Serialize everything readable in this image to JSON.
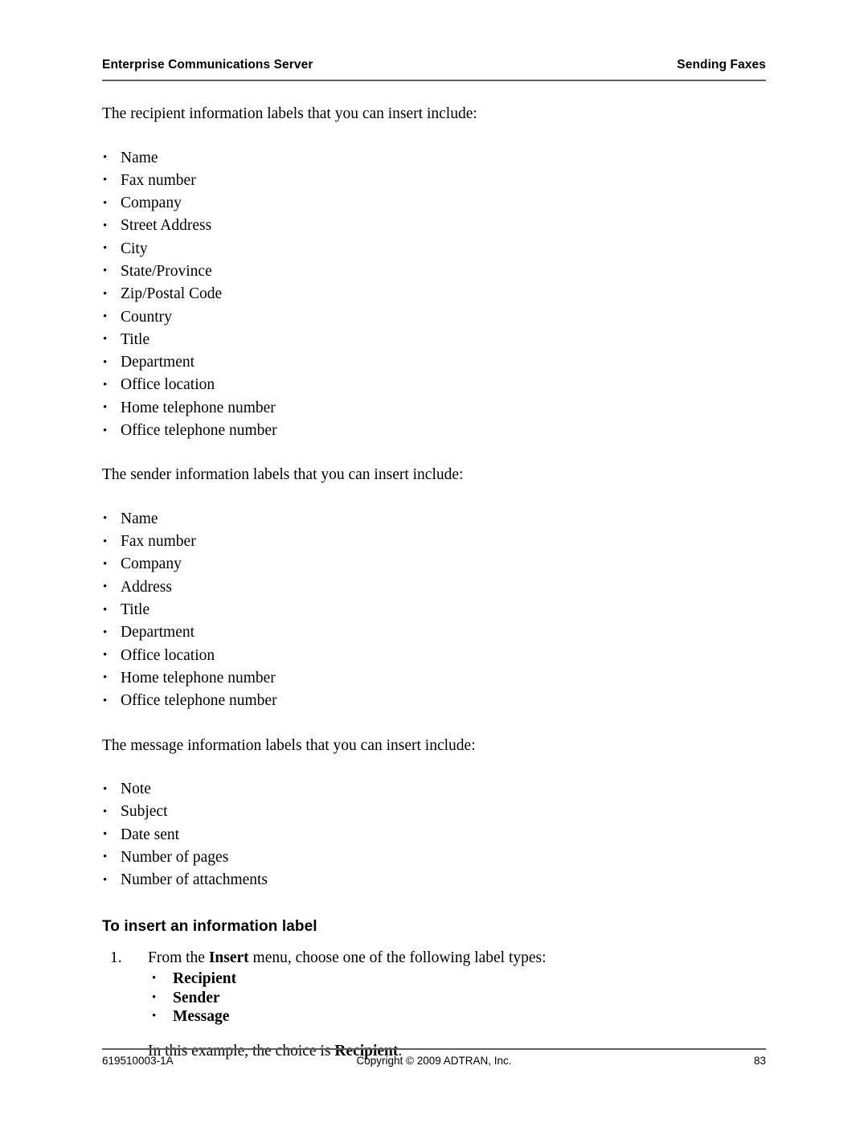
{
  "header": {
    "left": "Enterprise Communications Server",
    "right": "Sending Faxes"
  },
  "body": {
    "recipient_intro": "The recipient information labels that you can insert include:",
    "recipient_labels": [
      "Name",
      "Fax number",
      "Company",
      "Street Address",
      "City",
      "State/Province",
      "Zip/Postal Code",
      "Country",
      "Title",
      "Department",
      "Office location",
      "Home telephone number",
      "Office telephone number"
    ],
    "sender_intro": "The sender information labels that you can insert include:",
    "sender_labels": [
      "Name",
      "Fax number",
      "Company",
      "Address",
      "Title",
      "Department",
      "Office location",
      "Home telephone number",
      "Office telephone number"
    ],
    "message_intro": "The message information labels that you can insert include:",
    "message_labels": [
      "Note",
      "Subject",
      "Date sent",
      "Number of pages",
      "Number of attachments"
    ],
    "procedure_heading": "To insert an information label",
    "step_number": "1.",
    "step_text_part1": "From the ",
    "step_text_bold1": "Insert",
    "step_text_part2": " menu, choose one of the following label types:",
    "label_types": [
      "Recipient",
      "Sender",
      "Message"
    ],
    "example_part1": "In this example, the choice is ",
    "example_bold": "Recipient",
    "example_part2": "."
  },
  "footer": {
    "doc_number": "619510003-1A",
    "copyright": "Copyright © 2009 ADTRAN, Inc.",
    "page_number": "83"
  }
}
